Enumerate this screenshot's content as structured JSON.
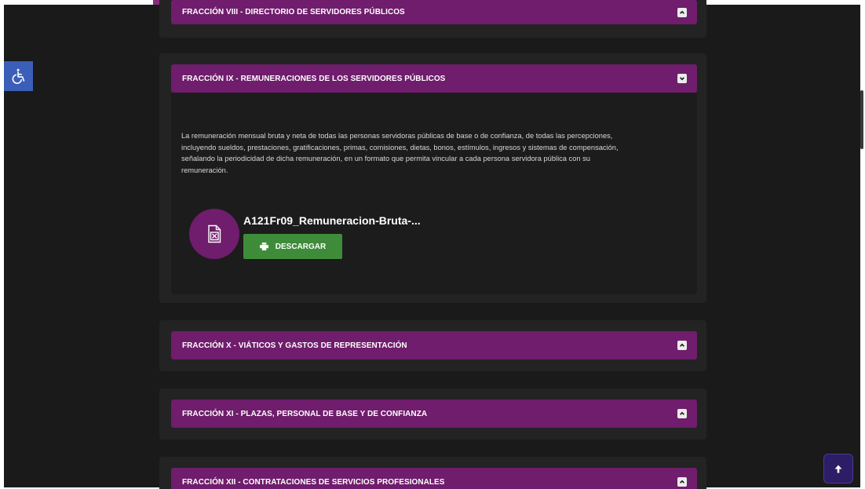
{
  "colors": {
    "header_bg": "#6f1d6c",
    "card_bg": "#232323",
    "page_bg": "#1a1a1a",
    "download_green": "#3e8c3a",
    "accessibility_blue": "#3b5eb8",
    "scroll_top_bg": "#2c1d66"
  },
  "accessibility": {
    "icon": "wheelchair-icon"
  },
  "sections": [
    {
      "title": "FRACCIÓN VIII - DIRECTORIO DE SERVIDORES PÚBLICOS",
      "state": "collapsed"
    },
    {
      "title": "FRACCIÓN IX - REMUNERACIONES DE LOS SERVIDORES PÚBLICOS",
      "state": "expanded",
      "description_lines": [
        "La remuneración mensual bruta y neta de todas las personas servidoras públicas de base o de confianza, de todas las percepciones,",
        "incluyendo sueldos, prestaciones, gratificaciones, primas, comisiones, dietas, bonos, estímulos, ingresos y sistemas de compensación,",
        "señalando la periodicidad de dicha remuneración, en un formato que permita vincular a cada persona servidora pública con su",
        "remuneración."
      ],
      "file": {
        "name": "A121Fr09_Remuneracion-Bruta-...",
        "icon": "excel-file-icon",
        "download_label": "DESCARGAR"
      }
    },
    {
      "title": "FRACCIÓN X - VIÁTICOS Y GASTOS DE REPRESENTACIÓN",
      "state": "collapsed"
    },
    {
      "title": "FRACCIÓN XI - PLAZAS, PERSONAL DE BASE Y DE CONFIANZA",
      "state": "collapsed"
    },
    {
      "title": "FRACCIÓN XII - CONTRATACIONES DE SERVICIOS PROFESIONALES",
      "state": "collapsed"
    }
  ],
  "scroll_top": {
    "icon": "arrow-up-icon"
  }
}
